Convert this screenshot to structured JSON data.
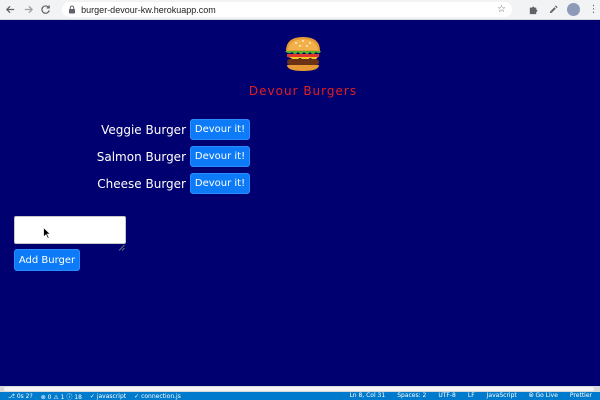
{
  "browser": {
    "url": "burger-devour-kw.herokuapp.com",
    "back_icon": "arrow-left",
    "forward_icon": "arrow-right",
    "reload_icon": "reload",
    "lock_icon": "lock",
    "star_icon": "star",
    "extensions_icon": "puzzle",
    "eyedropper_icon": "eyedropper",
    "menu_icon": "vertical-dots",
    "avatar_color": "#8d9bb8"
  },
  "colors": {
    "page_background": "#000070",
    "title_color": "#e41e1e",
    "button_color": "#0d7bf7",
    "statusbar_color": "#007acc"
  },
  "page": {
    "logo_icon": "burger-icon",
    "title": "Devour Burgers",
    "burgers": [
      {
        "name": "Veggie Burger",
        "button_label": "Devour it!"
      },
      {
        "name": "Salmon Burger",
        "button_label": "Devour it!"
      },
      {
        "name": "Cheese Burger",
        "button_label": "Devour it!"
      }
    ],
    "input_value": "",
    "add_button_label": "Add Burger"
  },
  "status_bar": {
    "left": [
      "⎇ 0s 2?",
      "⊗ 0 ⚠ 1 ⓘ 18",
      "✓ javascript",
      "✓ connection.js"
    ],
    "right": [
      "Ln 8, Col 31",
      "Spaces: 2",
      "UTF-8",
      "LF",
      "JavaScript",
      "⦾ Go Live",
      "Prettier"
    ]
  }
}
